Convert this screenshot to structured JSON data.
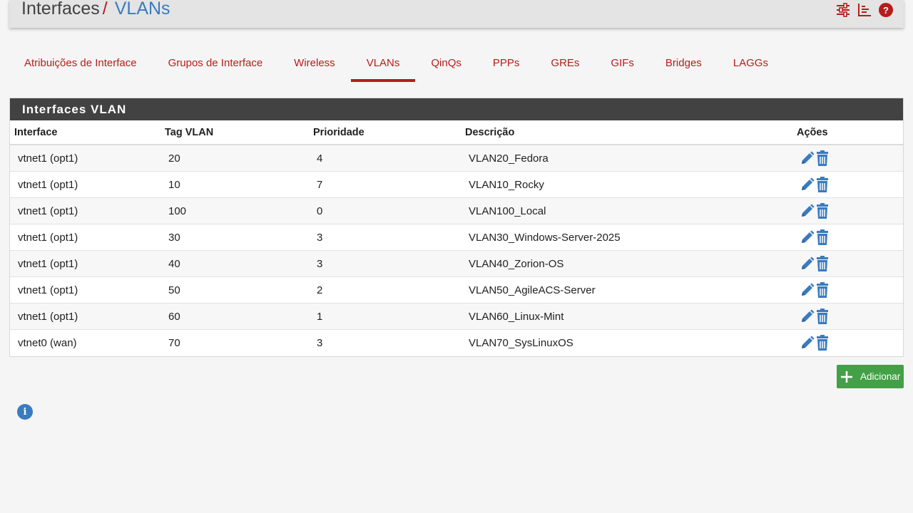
{
  "header": {
    "breadcrumb_root": "Interfaces",
    "breadcrumb_separator": "/",
    "breadcrumb_current": "VLANs",
    "icons": [
      "sliders-icon",
      "chart-icon",
      "help-icon"
    ],
    "help_glyph": "?"
  },
  "tabs": [
    {
      "label": "Atribuições de Interface",
      "active": false
    },
    {
      "label": "Grupos de Interface",
      "active": false
    },
    {
      "label": "Wireless",
      "active": false
    },
    {
      "label": "VLANs",
      "active": true
    },
    {
      "label": "QinQs",
      "active": false
    },
    {
      "label": "PPPs",
      "active": false
    },
    {
      "label": "GREs",
      "active": false
    },
    {
      "label": "GIFs",
      "active": false
    },
    {
      "label": "Bridges",
      "active": false
    },
    {
      "label": "LAGGs",
      "active": false
    }
  ],
  "panel": {
    "title": "Interfaces VLAN",
    "columns": [
      "Interface",
      "Tag VLAN",
      "Prioridade",
      "Descrição",
      "Ações"
    ],
    "rows": [
      {
        "interface": "vtnet1 (opt1)",
        "tag": "20",
        "priority": "4",
        "description": "VLAN20_Fedora"
      },
      {
        "interface": "vtnet1 (opt1)",
        "tag": "10",
        "priority": "7",
        "description": "VLAN10_Rocky"
      },
      {
        "interface": "vtnet1 (opt1)",
        "tag": "100",
        "priority": "0",
        "description": "VLAN100_Local"
      },
      {
        "interface": "vtnet1 (opt1)",
        "tag": "30",
        "priority": "3",
        "description": "VLAN30_Windows-Server-2025"
      },
      {
        "interface": "vtnet1 (opt1)",
        "tag": "40",
        "priority": "3",
        "description": "VLAN40_Zorion-OS"
      },
      {
        "interface": "vtnet1 (opt1)",
        "tag": "50",
        "priority": "2",
        "description": "VLAN50_AgileACS-Server"
      },
      {
        "interface": "vtnet1 (opt1)",
        "tag": "60",
        "priority": "1",
        "description": "VLAN60_Linux-Mint"
      },
      {
        "interface": "vtnet0 (wan)",
        "tag": "70",
        "priority": "3",
        "description": "VLAN70_SysLinuxOS"
      }
    ]
  },
  "add_button": {
    "label": "Adicionar",
    "icon": "plus-icon"
  },
  "info": {
    "icon": "info-icon",
    "glyph": "i"
  },
  "colors": {
    "accent_red": "#b71c1c",
    "link_blue": "#3a7bbf",
    "panel_heading": "#424242",
    "add_green": "#43a047"
  }
}
